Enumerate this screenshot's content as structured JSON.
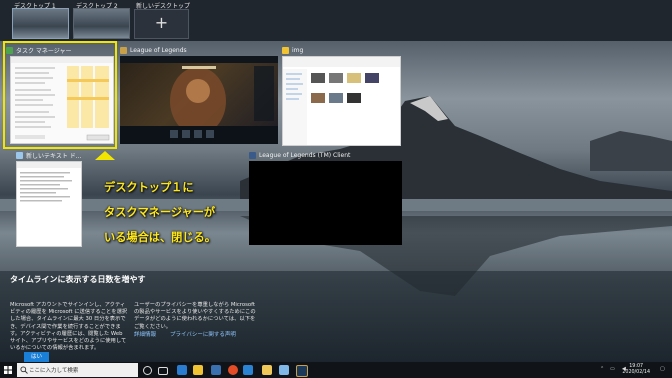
{
  "desktops": [
    {
      "label": "デスクトップ 1"
    },
    {
      "label": "デスクトップ 2"
    }
  ],
  "new_desktop": {
    "label": "新しいデスクトップ",
    "icon": "+"
  },
  "windows": {
    "task_manager": {
      "title": "タスク マネージャー"
    },
    "league": {
      "title": "League of Legends"
    },
    "explorer": {
      "title": "img"
    },
    "notepad": {
      "title": "新しいテキスト ド..."
    },
    "league_client": {
      "title": "League of Legends (TM) Client"
    }
  },
  "callout": {
    "line1": "デスクトップ１に",
    "line2": "タスクマネージャーが",
    "line3": "いる場合は、閉じる。"
  },
  "timeline": {
    "title": "タイムラインに表示する日数を増やす",
    "body_left": "Microsoft アカウントでサインインし、アクティビティの履歴を Microsoft に送信することを選択した場合、タイムラインに最大 30 日分を表示でき、デバイス間で作業を続行することができます。アクティビティの履歴には、閲覧した Web サイト、アプリやサービスをどのように使用しているかについての情報が含まれます。",
    "body_right": "ユーザーのプライバシーを尊重しながら Microsoft の製品やサービスをより使いやすくするためにこのデータがどのように使われるかについては、以下をご覧ください。",
    "link_more": "詳細情報",
    "link_privacy": "プライバシーに関する声明",
    "yes_button": "はい"
  },
  "taskbar": {
    "search_placeholder": "ここに入力して検索",
    "time": "19:07",
    "date": "2020/02/14"
  },
  "colors": {
    "highlight": "#f2e600",
    "callout_text": "#ffe81a",
    "accent": "#1a7fd6"
  }
}
